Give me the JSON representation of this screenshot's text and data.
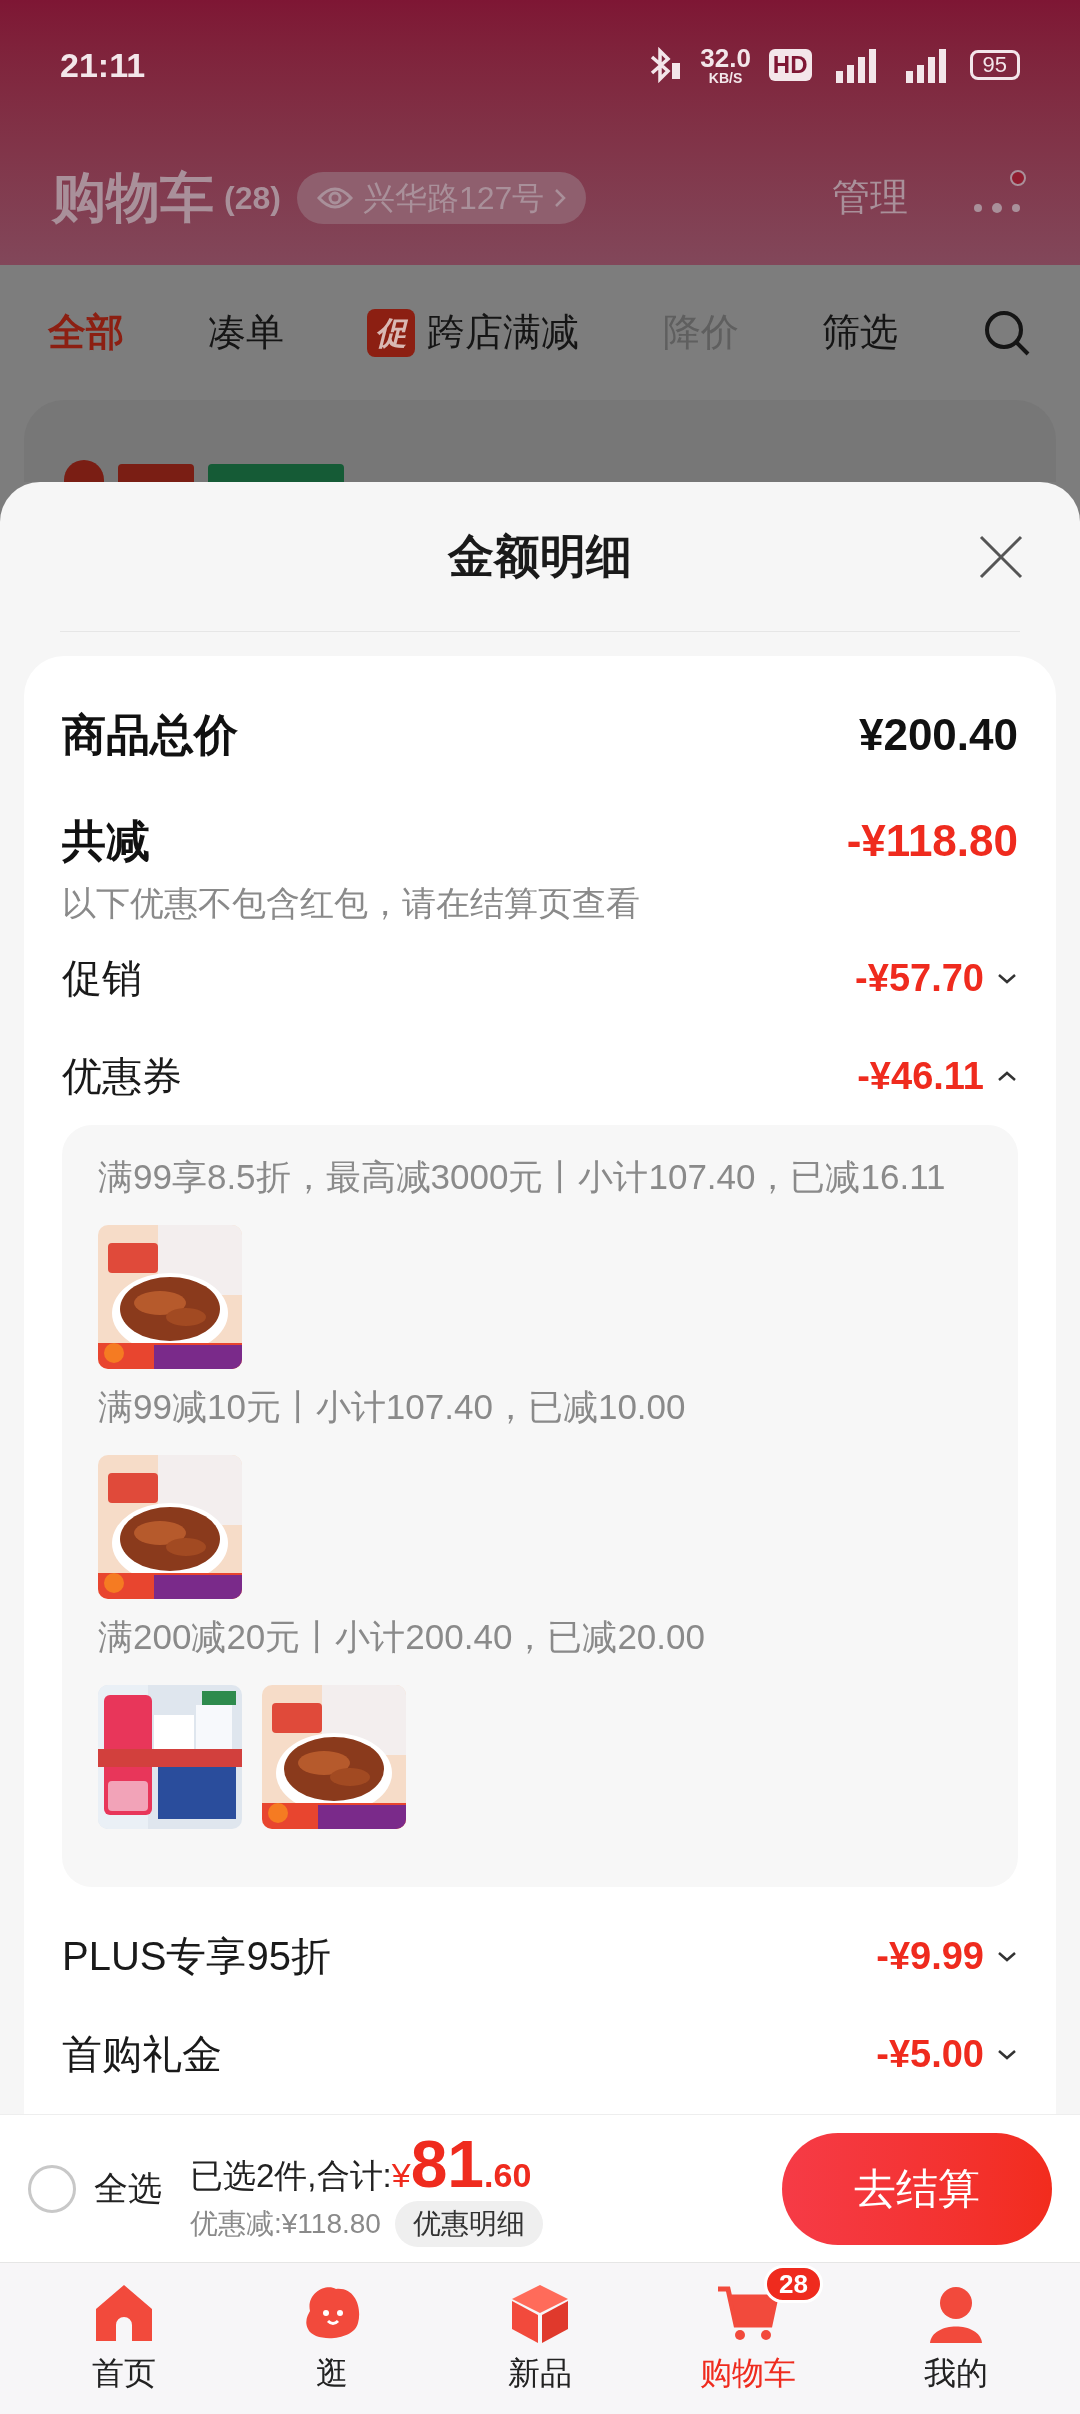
{
  "status_bar": {
    "time": "21:11",
    "speed": "32.0",
    "speed_unit": "KB/S",
    "hd": "HD",
    "battery": "95"
  },
  "header": {
    "title": "购物车",
    "count": "(28)",
    "address": "兴华路127号",
    "manage": "管理"
  },
  "filter_tabs": [
    {
      "label": "全部",
      "selected": true,
      "disabled": false
    },
    {
      "label": "凑单",
      "selected": false,
      "disabled": false
    },
    {
      "label": "跨店满减",
      "badge": "促",
      "selected": false,
      "disabled": false
    },
    {
      "label": "降价",
      "selected": false,
      "disabled": true
    },
    {
      "label": "筛选",
      "selected": false,
      "disabled": false
    }
  ],
  "sheet": {
    "title": "金额明细",
    "total": {
      "label": "商品总价",
      "value": "¥200.40"
    },
    "discount": {
      "label": "共减",
      "value": "-¥118.80",
      "note": "以下优惠不包含红包，请在结算页查看"
    },
    "items": [
      {
        "label": "促销",
        "value": "-¥57.70",
        "expanded": false
      },
      {
        "label": "优惠券",
        "value": "-¥46.11",
        "expanded": true,
        "coupons": [
          {
            "text": "满99享8.5折，最高减3000元丨小计107.40，已减16.11"
          },
          {
            "text": "满99减10元丨小计107.40，已减10.00"
          },
          {
            "text": "满200减20元丨小计200.40，已减20.00"
          }
        ]
      },
      {
        "label": "PLUS专享95折",
        "value": "-¥9.99",
        "expanded": false
      },
      {
        "label": "首购礼金",
        "value": "-¥5.00",
        "expanded": false
      }
    ]
  },
  "bottom_bar": {
    "select_all": {
      "label": "全选",
      "checked": false
    },
    "summary": "已选2件,合计:",
    "currency": "¥",
    "amount": "81",
    "amount_decimal": ".60",
    "saved": "优惠减:¥118.80",
    "detail_button": "优惠明细",
    "checkout": "去结算"
  },
  "nav": [
    {
      "label": "首页",
      "selected": false
    },
    {
      "label": "逛",
      "selected": false
    },
    {
      "label": "新品",
      "selected": false
    },
    {
      "label": "购物车",
      "selected": true,
      "badge": "28"
    },
    {
      "label": "我的",
      "selected": false
    }
  ]
}
